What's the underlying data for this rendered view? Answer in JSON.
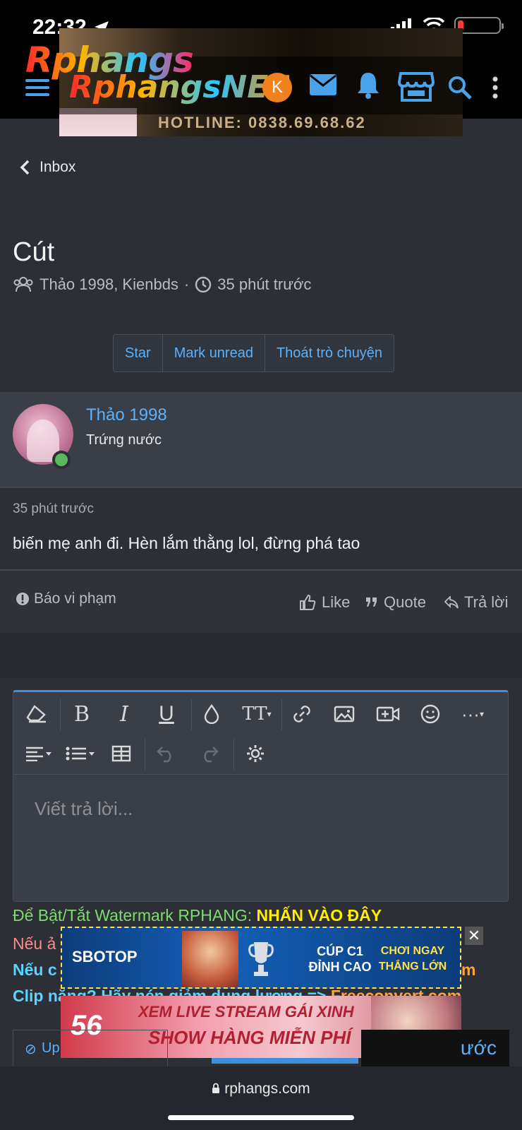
{
  "status_bar": {
    "time": "22:32",
    "battery_percent": 10
  },
  "header": {
    "logo_text": "Rphangs",
    "logo_text_2": "RphangsNET",
    "user_initial": "K",
    "ad_text": "HOTLINE: 0838.69.68.62"
  },
  "breadcrumb": {
    "back_label": "Inbox"
  },
  "conversation": {
    "title": "Cút",
    "participants": "Thảo 1998, Kienbds",
    "separator": "·",
    "time_ago": "35 phút trước",
    "buttons": {
      "star": "Star",
      "mark_unread": "Mark unread",
      "leave": "Thoát trò chuyện"
    }
  },
  "message": {
    "author": "Thảo 1998",
    "author_title": "Trứng nước",
    "time": "35 phút trước",
    "body": "biến mẹ anh đi. Hèn lắm thằng lol, đừng phá tao",
    "report_label": "Báo vi phạm",
    "like_label": "Like",
    "quote_label": "Quote",
    "reply_label": "Trả lời"
  },
  "editor": {
    "placeholder": "Viết trả lời..."
  },
  "promo": {
    "watermark_prefix": "Để Bật/Tắt Watermark RPHANG: ",
    "watermark_link": "NHẤN VÀO ĐÂY",
    "line2": "Nếu ả",
    "line3_left": "Nếu c",
    "line3_right": "om",
    "line4_left": "Clip nặng? Hãy nén giảm dung lượng => ",
    "line4_right": "Freeconvert.com"
  },
  "ads": {
    "ad1_brand": "SBOTOP",
    "ad1_mid": "CÚP C1 ĐỈNH CAO",
    "ad1_right": "CHƠI NGAY THẮNG LỚN",
    "ad2_logo": "56",
    "ad2_line1": "XEM LIVE STREAM GÁI XINH",
    "ad2_line2": "SHOW HÀNG MIỄN PHÍ",
    "close": "✕"
  },
  "footer": {
    "upload_label": "Up",
    "submit_label": "ước",
    "url": "rphangs.com"
  },
  "colors": {
    "accent": "#5ab2ff",
    "background": "#2c2f36",
    "avatar_orange": "#f0821e",
    "online_green": "#5cb85c"
  }
}
